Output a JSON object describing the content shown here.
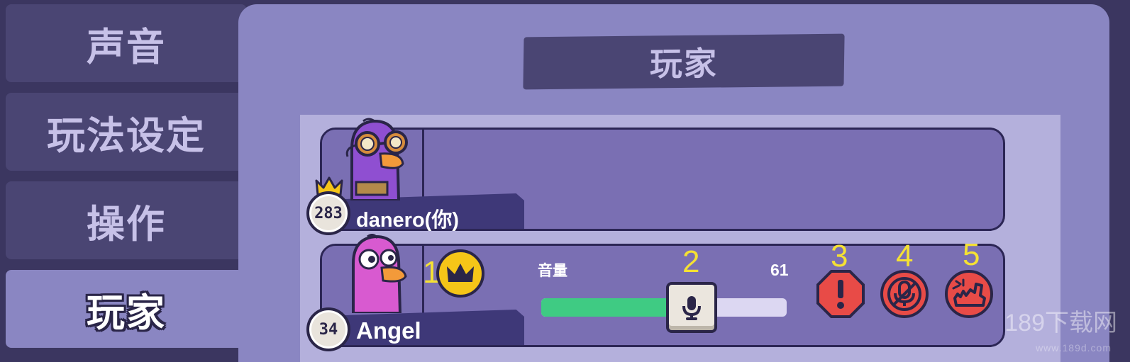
{
  "sidebar": {
    "tabs": [
      {
        "label": "声音",
        "active": false
      },
      {
        "label": "玩法设定",
        "active": false
      },
      {
        "label": "操作",
        "active": false
      },
      {
        "label": "玩家",
        "active": true
      }
    ]
  },
  "panel": {
    "title": "玩家"
  },
  "players": [
    {
      "name": "danero(你)",
      "level": "283",
      "has_crown": true,
      "avatar_color": "purple"
    },
    {
      "name": "Angel",
      "level": "34",
      "avatar_color": "pink",
      "volume_label": "音量",
      "volume_value": "61",
      "volume_fraction": 0.55,
      "buttons": [
        {
          "icon": "crown-icon",
          "number": "1"
        },
        {
          "icon": "microphone-icon",
          "number": "2"
        },
        {
          "icon": "report-icon",
          "number": "3"
        },
        {
          "icon": "mute-icon",
          "number": "4"
        },
        {
          "icon": "kick-icon",
          "number": "5"
        }
      ]
    }
  ],
  "colors": {
    "accent_yellow": "#f5e133",
    "danger_red": "#e84b47",
    "slider_green": "#3fcb83",
    "panel": "#8a86c2"
  },
  "watermark": {
    "text": "189下载网",
    "sub": "www.189d.com"
  }
}
